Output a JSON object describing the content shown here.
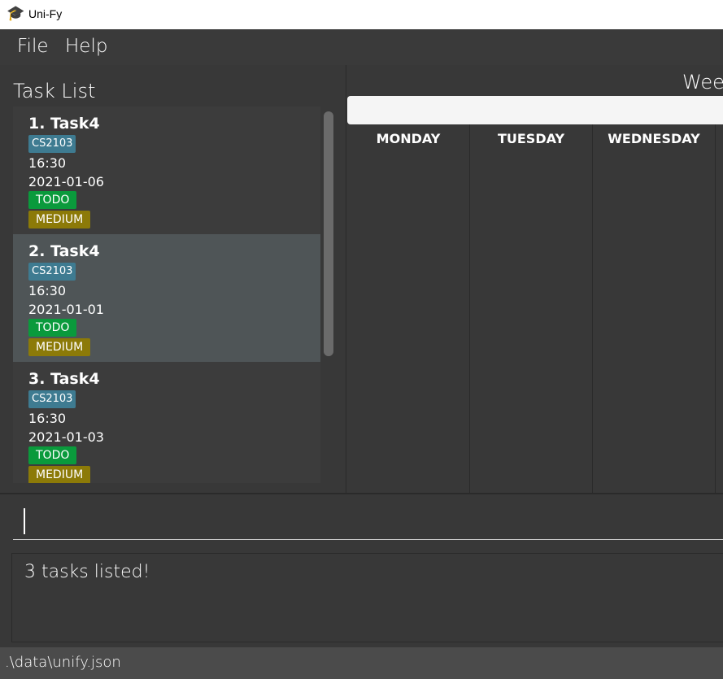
{
  "window": {
    "title": "Uni-Fy",
    "icon": "graduation-cap-icon"
  },
  "menu": {
    "file": "File",
    "help": "Help"
  },
  "task_list": {
    "heading": "Task List",
    "tasks": [
      {
        "index_title": "1.  Task4",
        "tag": "CS2103",
        "time": "16:30",
        "date": "2021-01-06",
        "state": "TODO",
        "priority": "MEDIUM"
      },
      {
        "index_title": "2.  Task4",
        "tag": "CS2103",
        "time": "16:30",
        "date": "2021-01-01",
        "state": "TODO",
        "priority": "MEDIUM"
      },
      {
        "index_title": "3.  Task4",
        "tag": "CS2103",
        "time": "16:30",
        "date": "2021-01-03",
        "state": "TODO",
        "priority": "MEDIUM"
      }
    ]
  },
  "calendar": {
    "week_label": "Wee",
    "days": [
      "MONDAY",
      "TUESDAY",
      "WEDNESDAY"
    ]
  },
  "command": {
    "value": ""
  },
  "result": {
    "message": "3 tasks listed!"
  },
  "status": {
    "path": ".\\data\\unify.json"
  },
  "colors": {
    "tag": "#3e7b91",
    "todo": "#0a9a3c",
    "medium": "#8c7a08",
    "selected": "#4f5557"
  }
}
